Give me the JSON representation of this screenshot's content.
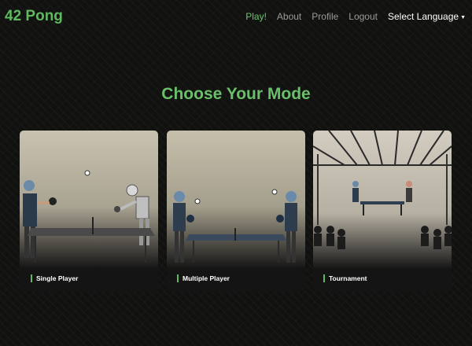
{
  "navbar": {
    "brand": "42 Pong",
    "links": [
      {
        "label": "Play!",
        "active": true
      },
      {
        "label": "About",
        "active": false
      },
      {
        "label": "Profile",
        "active": false
      },
      {
        "label": "Logout",
        "active": false
      }
    ],
    "language": {
      "label": "Select Language",
      "icon": "chevron-down-icon"
    }
  },
  "main": {
    "title": "Choose Your Mode",
    "cards": [
      {
        "label": "Single Player",
        "image": "human-vs-robot-table-tennis"
      },
      {
        "label": "Multiple Player",
        "image": "two-players-table-tennis"
      },
      {
        "label": "Tournament",
        "image": "tournament-hall-with-audience"
      }
    ]
  },
  "colors": {
    "accent": "#5fb95f",
    "background": "#111210",
    "nav_text": "#9a9a9a",
    "language_text": "#ffffff"
  }
}
